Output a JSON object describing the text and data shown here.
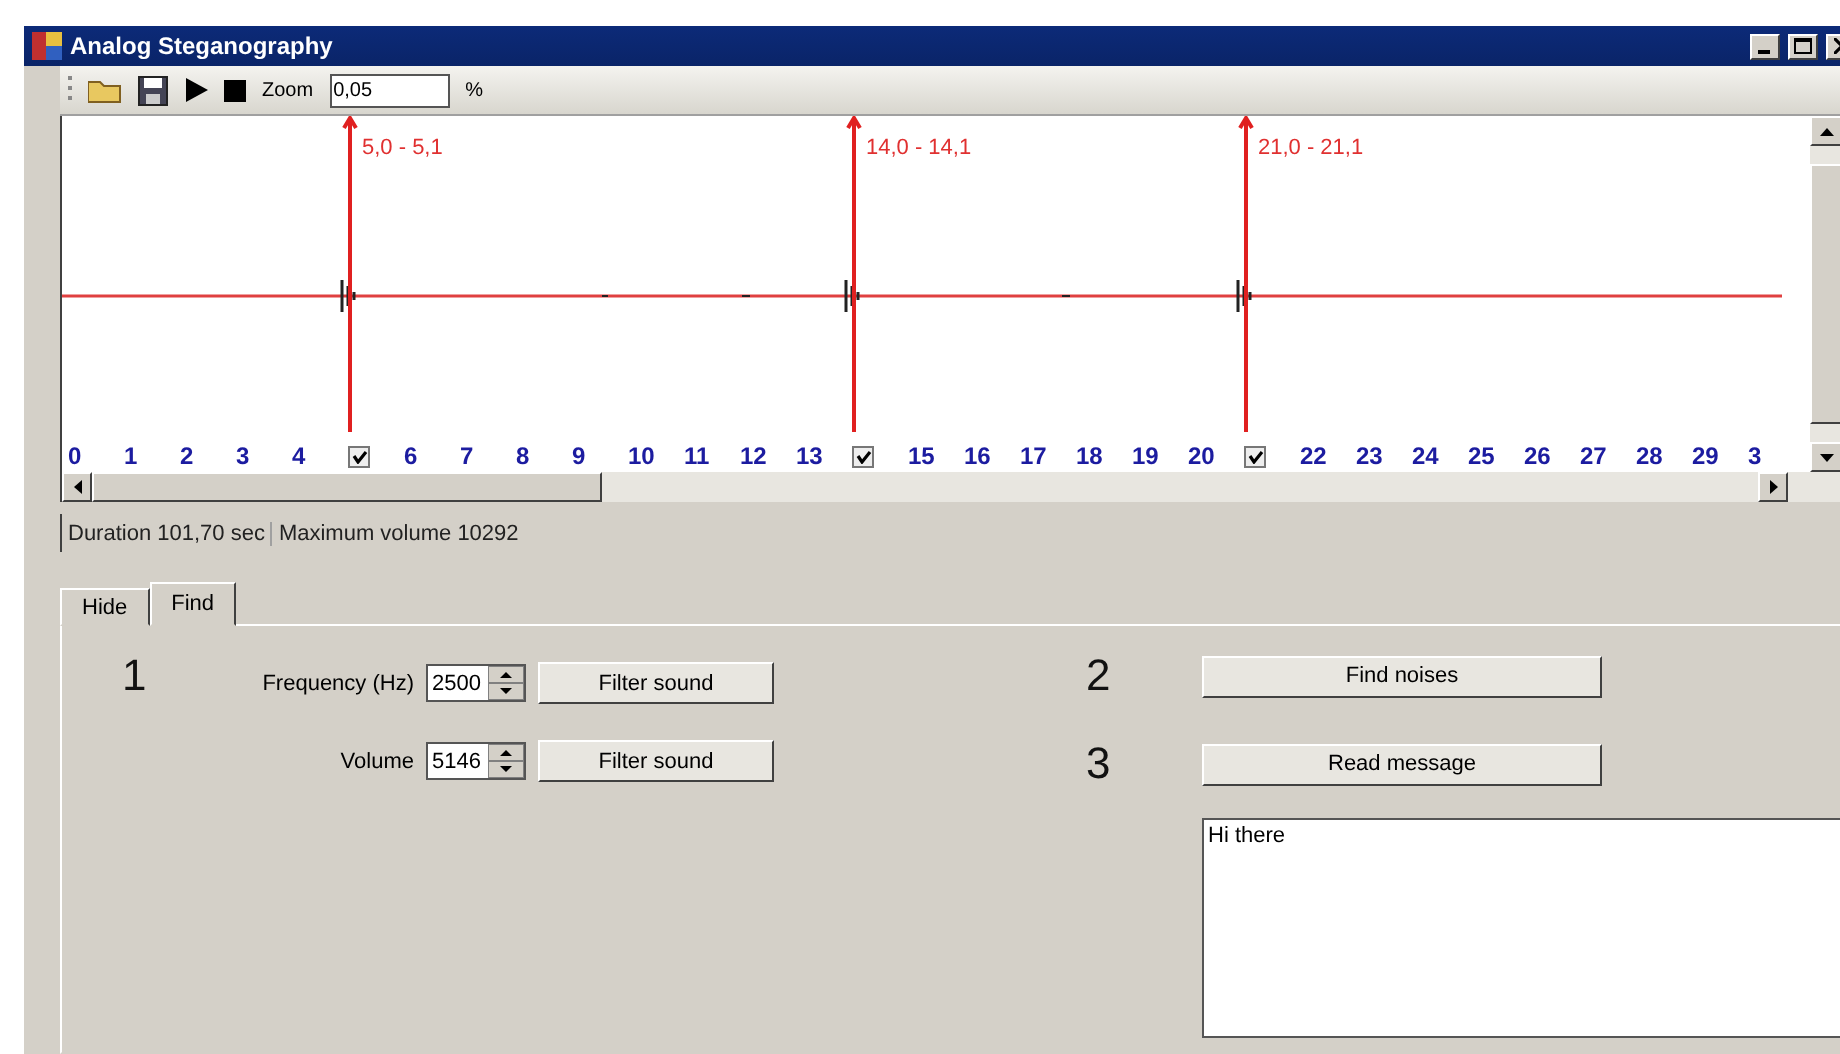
{
  "window": {
    "title": "Analog Steganography"
  },
  "toolbar": {
    "zoom_label": "Zoom",
    "zoom_value": "0,05",
    "unit": "%"
  },
  "waveform": {
    "markers": [
      {
        "label": "5,0 - 5,1"
      },
      {
        "label": "14,0 - 14,1"
      },
      {
        "label": "21,0 - 21,1"
      }
    ],
    "ticks": [
      {
        "kind": "number",
        "label": "0"
      },
      {
        "kind": "number",
        "label": "1"
      },
      {
        "kind": "number",
        "label": "2"
      },
      {
        "kind": "number",
        "label": "3"
      },
      {
        "kind": "number",
        "label": "4"
      },
      {
        "kind": "checkbox",
        "checked": true
      },
      {
        "kind": "number",
        "label": "6"
      },
      {
        "kind": "number",
        "label": "7"
      },
      {
        "kind": "number",
        "label": "8"
      },
      {
        "kind": "number",
        "label": "9"
      },
      {
        "kind": "number",
        "label": "10"
      },
      {
        "kind": "number",
        "label": "11"
      },
      {
        "kind": "number",
        "label": "12"
      },
      {
        "kind": "number",
        "label": "13"
      },
      {
        "kind": "checkbox",
        "checked": true
      },
      {
        "kind": "number",
        "label": "15"
      },
      {
        "kind": "number",
        "label": "16"
      },
      {
        "kind": "number",
        "label": "17"
      },
      {
        "kind": "number",
        "label": "18"
      },
      {
        "kind": "number",
        "label": "19"
      },
      {
        "kind": "number",
        "label": "20"
      },
      {
        "kind": "checkbox",
        "checked": true
      },
      {
        "kind": "number",
        "label": "22"
      },
      {
        "kind": "number",
        "label": "23"
      },
      {
        "kind": "number",
        "label": "24"
      },
      {
        "kind": "number",
        "label": "25"
      },
      {
        "kind": "number",
        "label": "26"
      },
      {
        "kind": "number",
        "label": "27"
      },
      {
        "kind": "number",
        "label": "28"
      },
      {
        "kind": "number",
        "label": "29"
      },
      {
        "kind": "number",
        "label": "3"
      }
    ]
  },
  "status_bar": [
    "Duration 101,70 sec",
    "Maximum volume 10292"
  ],
  "tabs": [
    {
      "label": "Hide",
      "selected": false
    },
    {
      "label": "Find",
      "selected": true
    }
  ],
  "find": {
    "step": "1",
    "filters": [
      {
        "label": "Frequency (Hz)",
        "value": "2500",
        "button": "Filter sound"
      },
      {
        "label": "Volume",
        "value": "5146",
        "button": "Filter sound"
      }
    ],
    "actions": [
      {
        "step": "2",
        "button": "Find noises"
      },
      {
        "step": "3",
        "button": "Read message"
      }
    ],
    "message": "Hi there"
  }
}
